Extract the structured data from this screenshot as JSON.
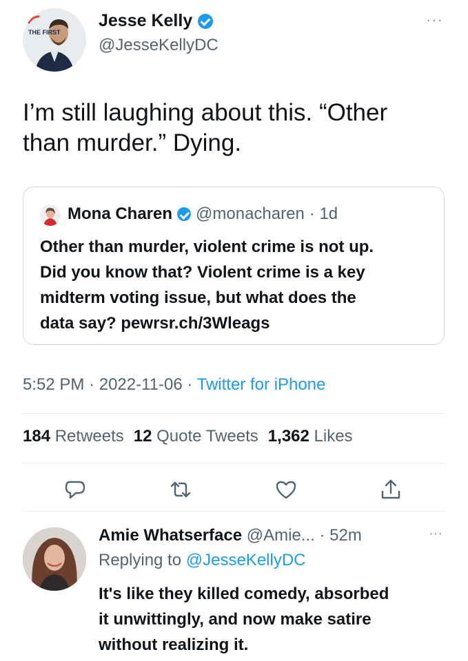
{
  "tweet": {
    "author": {
      "name": "Jesse Kelly",
      "handle": "@JesseKellyDC",
      "avatar_badge": "THE FIRST"
    },
    "text_line1": "I’m still laughing about this. “Other",
    "text_line2": "than murder.” Dying.",
    "quoted": {
      "name": "Mona Charen",
      "handle": "@monacharen",
      "time": "· 1d",
      "text_lines": [
        "Other than murder, violent crime is not up.",
        "Did you know that? Violent crime is a key",
        "midterm voting issue, but what does the",
        "data say? pewrsr.ch/3Wleags"
      ]
    },
    "time": "5:52 PM",
    "date": "2022-11-06",
    "source": "Twitter for iPhone",
    "separator": "·",
    "stats": {
      "retweets_count": "184",
      "retweets_label": "Retweets",
      "quotes_count": "12",
      "quotes_label": "Quote Tweets",
      "likes_count": "1,362",
      "likes_label": "Likes"
    },
    "more": "···"
  },
  "reply": {
    "name": "Amie Whatserface",
    "handle": "@Amie...",
    "time": "· 52m",
    "replying_prefix": "Replying to",
    "replying_to": "@JesseKellyDC",
    "text_lines": [
      "It's like they killed comedy, absorbed",
      "it unwittingly, and now make satire",
      "without realizing it."
    ],
    "more": "···"
  },
  "icons": {
    "verified": "verified-badge-icon",
    "reply": "reply-icon",
    "retweet": "retweet-icon",
    "like": "heart-icon",
    "share": "share-icon"
  },
  "colors": {
    "accent": "#1d9bf0",
    "text": "#0f1419",
    "secondary": "#536471",
    "border": "#cfd9de"
  }
}
